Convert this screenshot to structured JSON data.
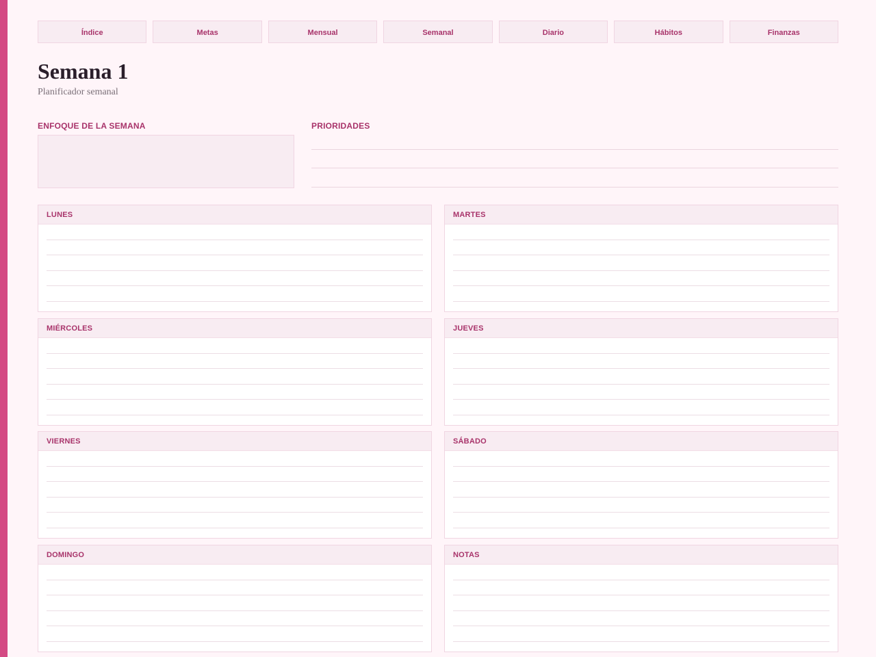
{
  "nav": {
    "tabs": [
      {
        "label": "Índice"
      },
      {
        "label": "Metas"
      },
      {
        "label": "Mensual"
      },
      {
        "label": "Semanal"
      },
      {
        "label": "Diario"
      },
      {
        "label": "Hábitos"
      },
      {
        "label": "Finanzas"
      }
    ]
  },
  "header": {
    "title": "Semana 1",
    "subtitle": "Planificador semanal"
  },
  "focus": {
    "label": "ENFOQUE DE LA SEMANA"
  },
  "priorities": {
    "label": "PRIORIDADES"
  },
  "days": [
    {
      "label": "LUNES"
    },
    {
      "label": "MARTES"
    },
    {
      "label": "MIÉRCOLES"
    },
    {
      "label": "JUEVES"
    },
    {
      "label": "VIERNES"
    },
    {
      "label": "SÁBADO"
    },
    {
      "label": "DOMINGO"
    },
    {
      "label": "NOTAS"
    }
  ],
  "colors": {
    "accent": "#d44a84",
    "label": "#a8336a",
    "background": "#fff5f9",
    "panel": "#f8ecf2"
  }
}
